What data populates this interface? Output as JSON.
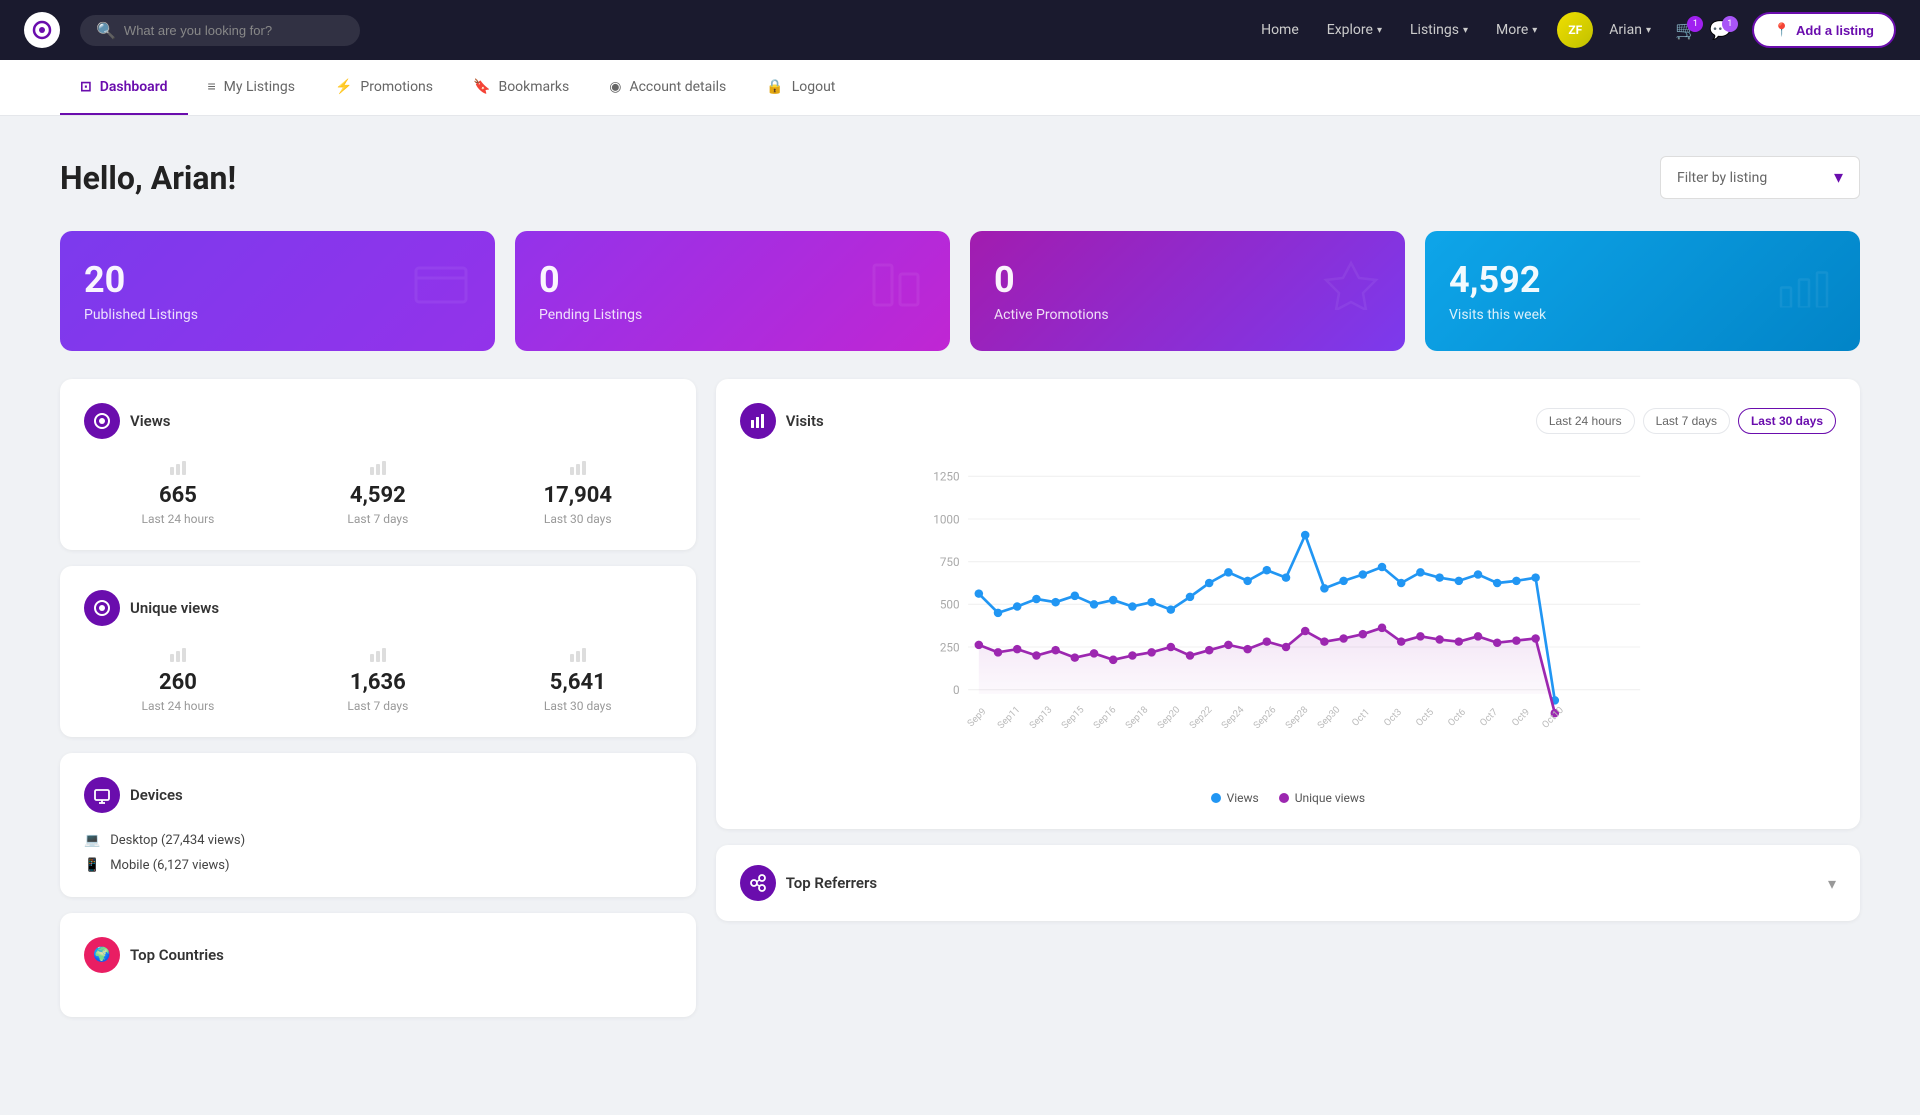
{
  "nav": {
    "logo_text": "⊙",
    "search_placeholder": "What are you looking for?",
    "links": [
      "Home",
      "Explore",
      "Listings",
      "More",
      "Arian"
    ],
    "explore_chevron": "▾",
    "listings_chevron": "▾",
    "more_chevron": "▾",
    "arian_chevron": "▾",
    "add_listing_label": "Add a listing",
    "cart_badge": "1",
    "notification_badge": "1"
  },
  "sub_nav": {
    "items": [
      {
        "id": "dashboard",
        "label": "Dashboard",
        "icon": "⊡",
        "active": true
      },
      {
        "id": "my-listings",
        "label": "My Listings",
        "icon": "≡",
        "active": false
      },
      {
        "id": "promotions",
        "label": "Promotions",
        "icon": "⚡",
        "active": false
      },
      {
        "id": "bookmarks",
        "label": "Bookmarks",
        "icon": "🔖",
        "active": false
      },
      {
        "id": "account-details",
        "label": "Account details",
        "icon": "◉",
        "active": false
      },
      {
        "id": "logout",
        "label": "Logout",
        "icon": "🔒",
        "active": false
      }
    ]
  },
  "header": {
    "greeting": "Hello, Arian!",
    "filter_label": "Filter by listing",
    "filter_chevron": "▾"
  },
  "stat_cards": [
    {
      "id": "published",
      "number": "20",
      "label": "Published Listings",
      "icon": "⊡",
      "class": "card-published"
    },
    {
      "id": "pending",
      "number": "0",
      "label": "Pending Listings",
      "icon": "▦",
      "class": "card-pending"
    },
    {
      "id": "promotions",
      "number": "0",
      "label": "Active Promotions",
      "icon": "⚡",
      "class": "card-promotions"
    },
    {
      "id": "visits",
      "number": "4,592",
      "label": "Visits this week",
      "icon": "▯▯▮",
      "class": "card-visits"
    }
  ],
  "views_card": {
    "title": "Views",
    "stats": [
      {
        "value": "665",
        "label": "Last 24 hours"
      },
      {
        "value": "4,592",
        "label": "Last 7 days"
      },
      {
        "value": "17,904",
        "label": "Last 30 days"
      }
    ]
  },
  "unique_views_card": {
    "title": "Unique views",
    "stats": [
      {
        "value": "260",
        "label": "Last 24 hours"
      },
      {
        "value": "1,636",
        "label": "Last 7 days"
      },
      {
        "value": "5,641",
        "label": "Last 30 days"
      }
    ]
  },
  "devices_card": {
    "title": "Devices",
    "items": [
      {
        "icon": "💻",
        "label": "Desktop (27,434 views)"
      },
      {
        "icon": "📱",
        "label": "Mobile (6,127 views)"
      }
    ]
  },
  "countries_card": {
    "title": "Top Countries"
  },
  "visits_chart": {
    "title": "Visits",
    "time_filters": [
      "Last 24 hours",
      "Last 7 days",
      "Last 30 days"
    ],
    "active_filter": "Last 30 days",
    "y_labels": [
      "1250",
      "1000",
      "750",
      "500",
      "250",
      "0"
    ],
    "legend": [
      {
        "label": "Views",
        "color": "#2196F3"
      },
      {
        "label": "Unique views",
        "color": "#9c27b0"
      }
    ]
  },
  "referrers_card": {
    "title": "Top Referrers",
    "icon": "🔗"
  }
}
